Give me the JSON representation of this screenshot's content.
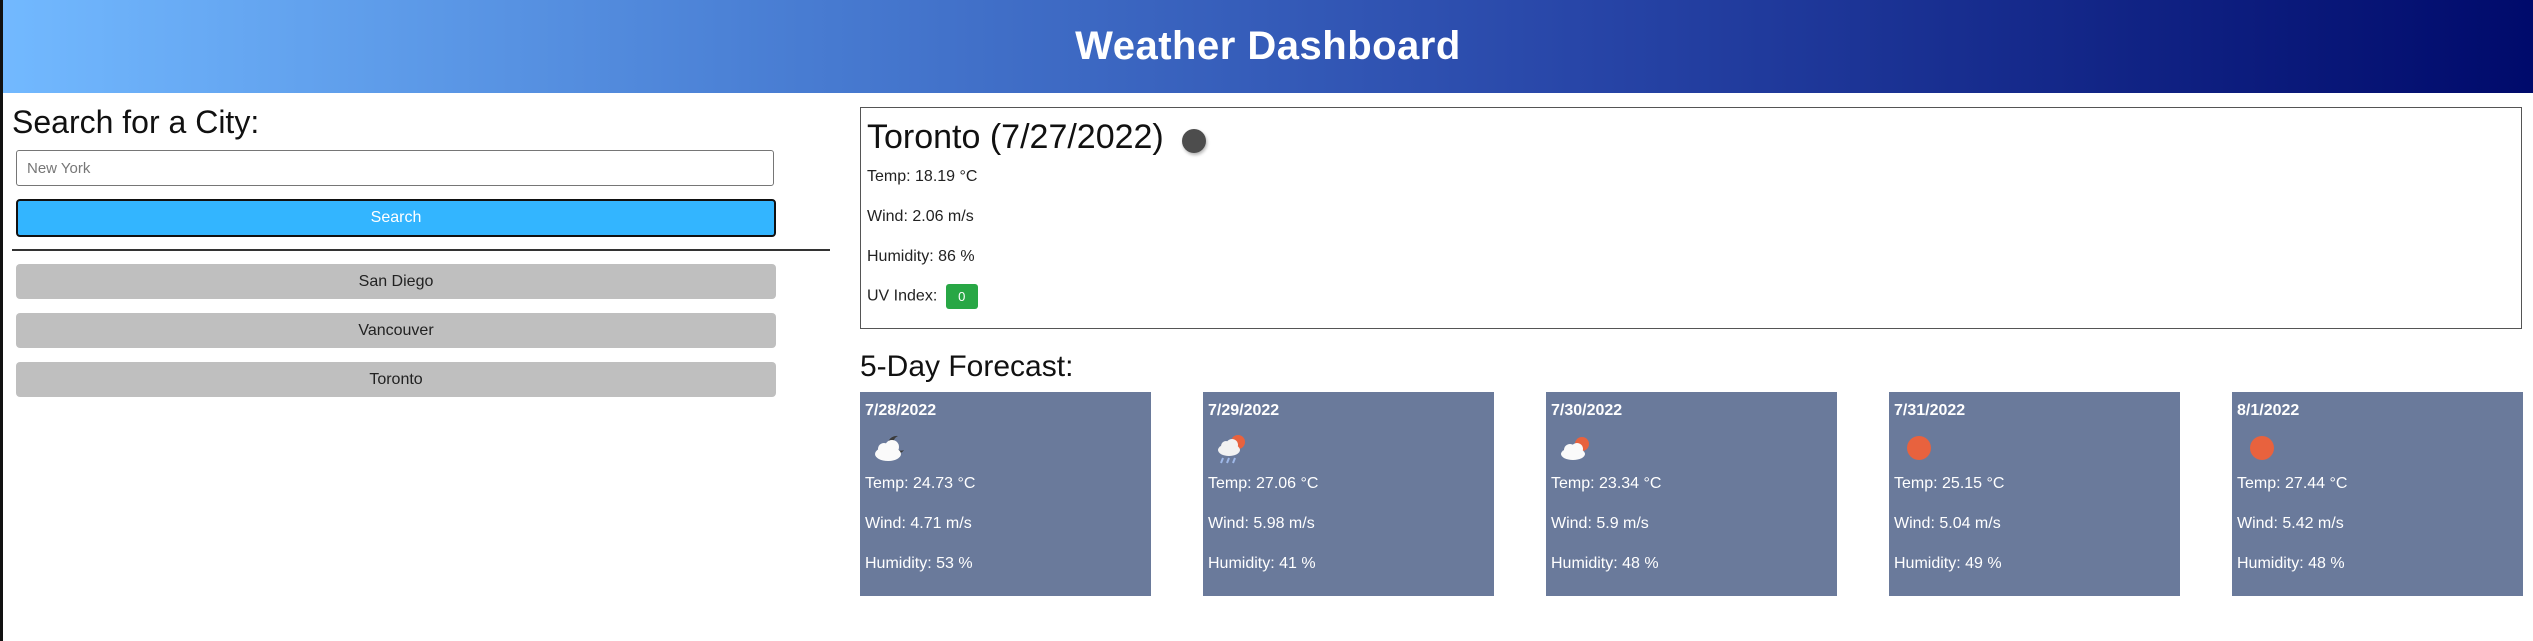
{
  "header": {
    "title": "Weather Dashboard"
  },
  "search": {
    "heading": "Search for a City:",
    "placeholder": "New York",
    "button_label": "Search"
  },
  "history": [
    {
      "label": "San Diego"
    },
    {
      "label": "Vancouver"
    },
    {
      "label": "Toronto"
    }
  ],
  "current": {
    "title": "Toronto (7/27/2022)",
    "temp": "Temp: 18.19 °C",
    "wind": "Wind: 2.06 m/s",
    "humidity": "Humidity: 86 %",
    "uv_label": "UV Index:",
    "uv_value": "0",
    "uv_color": "#28a745"
  },
  "forecast": {
    "heading": "5-Day Forecast:",
    "days": [
      {
        "date": "7/28/2022",
        "icon": "cloudy-night-icon",
        "temp": "Temp: 24.73 °C",
        "wind": "Wind: 4.71 m/s",
        "humidity": "Humidity: 53 %"
      },
      {
        "date": "7/29/2022",
        "icon": "cloud-rain-sun-icon",
        "temp": "Temp: 27.06 °C",
        "wind": "Wind: 5.98 m/s",
        "humidity": "Humidity: 41 %"
      },
      {
        "date": "7/30/2022",
        "icon": "cloud-sun-icon",
        "temp": "Temp: 23.34 °C",
        "wind": "Wind: 5.9 m/s",
        "humidity": "Humidity: 48 %"
      },
      {
        "date": "7/31/2022",
        "icon": "sun-icon",
        "temp": "Temp: 25.15 °C",
        "wind": "Wind: 5.04 m/s",
        "humidity": "Humidity: 49 %"
      },
      {
        "date": "8/1/2022",
        "icon": "sun-icon",
        "temp": "Temp: 27.44 °C",
        "wind": "Wind: 5.42 m/s",
        "humidity": "Humidity: 48 %"
      }
    ]
  },
  "colors": {
    "header_gradient_start": "#72b9ff",
    "header_gradient_end": "#000a6b",
    "search_button": "#33b5ff",
    "history_button": "#bfbfbf",
    "forecast_card": "#6a7a9b",
    "sun": "#e8623e"
  }
}
